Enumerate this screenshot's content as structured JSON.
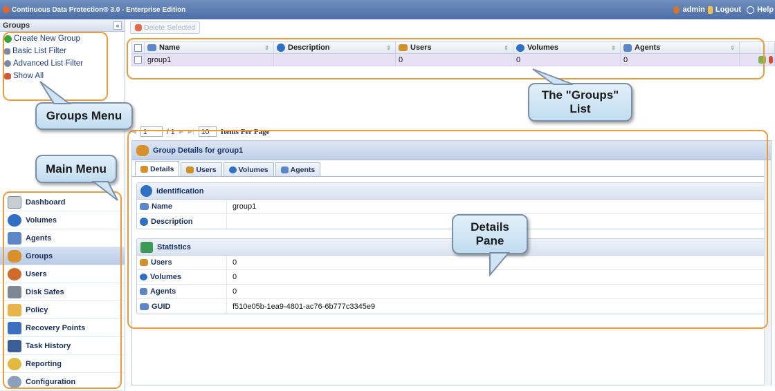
{
  "app": {
    "title": "Continuous Data Protection® 3.0 - Enterprise Edition",
    "user": "admin",
    "logout": "Logout",
    "help": "Help"
  },
  "groups_panel": {
    "header": "Groups",
    "collapse_glyph": "«",
    "links": [
      {
        "label": "Create New Group",
        "icon": "add-icon"
      },
      {
        "label": "Basic List Filter",
        "icon": "filter-icon"
      },
      {
        "label": "Advanced List Filter",
        "icon": "advanced-filter-icon"
      },
      {
        "label": "Show All",
        "icon": "show-all-icon"
      }
    ]
  },
  "main_menu": [
    {
      "label": "Dashboard",
      "icon": "dashboard-icon",
      "selected": false
    },
    {
      "label": "Volumes",
      "icon": "volumes-icon",
      "selected": false
    },
    {
      "label": "Agents",
      "icon": "agents-icon",
      "selected": false
    },
    {
      "label": "Groups",
      "icon": "groups-icon",
      "selected": true
    },
    {
      "label": "Users",
      "icon": "users-icon",
      "selected": false
    },
    {
      "label": "Disk Safes",
      "icon": "disk-safes-icon",
      "selected": false
    },
    {
      "label": "Policy",
      "icon": "policy-icon",
      "selected": false
    },
    {
      "label": "Recovery Points",
      "icon": "recovery-points-icon",
      "selected": false
    },
    {
      "label": "Task History",
      "icon": "task-history-icon",
      "selected": false
    },
    {
      "label": "Reporting",
      "icon": "reporting-icon",
      "selected": false
    },
    {
      "label": "Configuration",
      "icon": "configuration-icon",
      "selected": false
    }
  ],
  "toolbar": {
    "delete_selected": "Delete Selected"
  },
  "grid": {
    "columns": [
      "Name",
      "Description",
      "Users",
      "Volumes",
      "Agents"
    ],
    "rows": [
      {
        "name": "group1",
        "description": "",
        "users": "0",
        "volumes": "0",
        "agents": "0"
      }
    ]
  },
  "pager": {
    "page": "1",
    "total": "/ 1",
    "per_page": "10",
    "per_page_label": "Items Per Page"
  },
  "details": {
    "title": "Group Details for group1",
    "tabs": [
      "Details",
      "Users",
      "Volumes",
      "Agents"
    ],
    "identification": {
      "header": "Identification",
      "name_label": "Name",
      "name_value": "group1",
      "description_label": "Description",
      "description_value": ""
    },
    "statistics": {
      "header": "Statistics",
      "rows": [
        {
          "label": "Users",
          "value": "0"
        },
        {
          "label": "Volumes",
          "value": "0"
        },
        {
          "label": "Agents",
          "value": "0"
        },
        {
          "label": "GUID",
          "value": "f510e05b-1ea9-4801-ac76-6b777c3345e9"
        }
      ]
    }
  },
  "callouts": {
    "groups_menu": "Groups Menu",
    "main_menu": "Main Menu",
    "groups_list": "The \"Groups\" List",
    "details_pane": "Details Pane"
  },
  "colors": {
    "accent_outline": "#ef9a3a",
    "titlebar": "#5577ae",
    "selected_row": "#e6e1f5"
  }
}
